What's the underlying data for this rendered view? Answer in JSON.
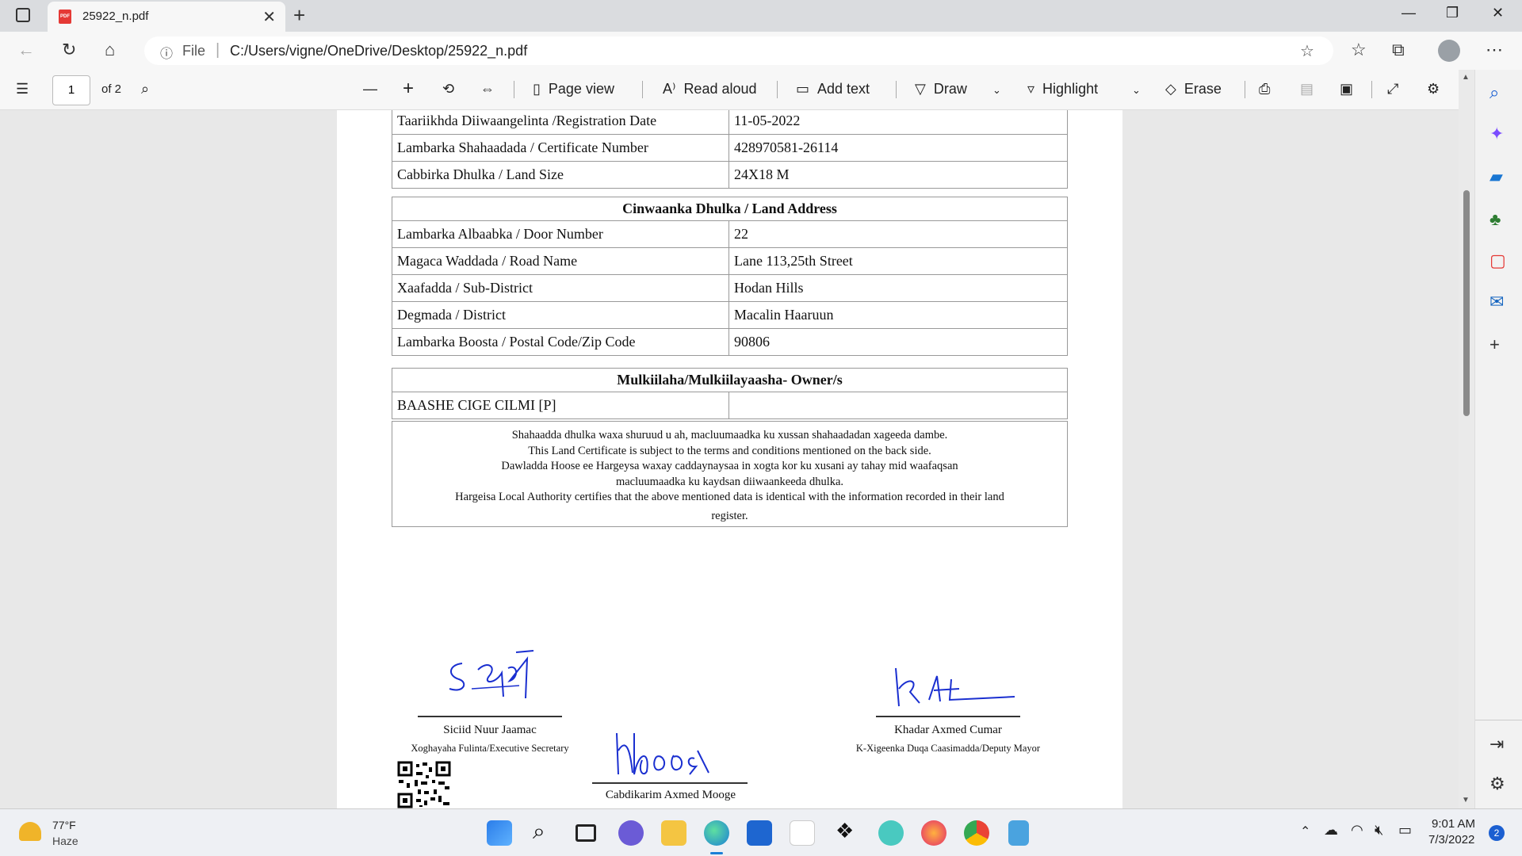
{
  "browser": {
    "tab_title": "25922_n.pdf",
    "address_prefix": "File",
    "url": "C:/Users/vigne/OneDrive/Desktop/25922_n.pdf"
  },
  "pdf_toolbar": {
    "page_number": "1",
    "page_total": "of 2",
    "page_view": "Page view",
    "read_aloud": "Read aloud",
    "add_text": "Add text",
    "draw": "Draw",
    "highlight": "Highlight",
    "erase": "Erase"
  },
  "document": {
    "top_rows": [
      {
        "label": "Taariikhda Diiwaangelinta /Registration Date",
        "value": "11-05-2022"
      },
      {
        "label": "Lambarka Shahaadada / Certificate Number",
        "value": "428970581-26114"
      },
      {
        "label": "Cabbirka Dhulka / Land Size",
        "value": "24X18 M"
      }
    ],
    "address_header": "Cinwaanka Dhulka / Land Address",
    "address_rows": [
      {
        "label": "Lambarka Albaabka / Door Number",
        "value": "22"
      },
      {
        "label": "Magaca Waddada / Road Name",
        "value": "Lane 113,25th Street"
      },
      {
        "label": "Xaafadda / Sub-District",
        "value": "Hodan Hills"
      },
      {
        "label": "Degmada / District",
        "value": "Macalin Haaruun"
      },
      {
        "label": "Lambarka Boosta / Postal Code/Zip Code",
        "value": "90806"
      }
    ],
    "owner_header": "Mulkiilaha/Mulkiilayaasha- Owner/s",
    "owner_name": "BAASHE CIGE CILMI [P]",
    "terms": [
      "Shahaadda dhulka waxa shuruud u ah, macluumaadka ku xussan shahaadadan xageeda dambe.",
      "This Land Certificate is subject to the terms and conditions mentioned on the back side.",
      "Dawladda Hoose ee Hargeysa waxay caddaynaysaa in xogta kor ku xusani ay tahay mid waafaqsan",
      "macluumaadka ku kaydsan diiwaankeeda dhulka.",
      "Hargeisa Local Authority certifies that the above mentioned data is identical with the information recorded in their land",
      "register."
    ],
    "signatories": {
      "left_name": "Siciid Nuur Jaamac",
      "left_title": "Xoghayaha Fulinta/Executive Secretary",
      "right_name": "Khadar Axmed Cumar",
      "right_title": "K-Xigeenka Duqa Caasimadda/Deputy Mayor",
      "center_name": "Cabdikarim Axmed Mooge"
    }
  },
  "taskbar": {
    "weather_temp": "77°F",
    "weather_desc": "Haze",
    "time": "9:01 AM",
    "date": "7/3/2022",
    "notification_count": "2"
  }
}
